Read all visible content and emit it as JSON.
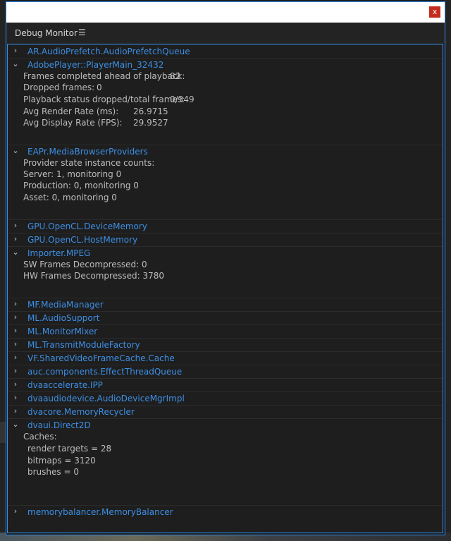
{
  "panel": {
    "title": "Debug Monitor",
    "menu_icon": "hamburger-icon",
    "close_glyph": "x"
  },
  "groups": [
    {
      "label": "AR.AudioPrefetch.AudioPrefetchQueue",
      "expanded": false
    },
    {
      "label": "AdobePlayer::PlayerMain_32432",
      "expanded": true,
      "details": [
        {
          "label": "Frames completed ahead of playback:",
          "value": "82"
        },
        {
          "label": "Dropped frames:",
          "value": "0"
        },
        {
          "label": "Playback status dropped/total frames:",
          "value": "0/349"
        },
        {
          "label": "Avg Render Rate (ms):",
          "value": "26.9715"
        },
        {
          "label": "Avg Display Rate (FPS):",
          "value": "29.9527"
        }
      ]
    },
    {
      "label": "EAPr.MediaBrowserProviders",
      "expanded": true,
      "lines": [
        "Provider state instance counts:",
        "Server: 1, monitoring 0",
        "Production: 0, monitoring 0",
        "Asset: 0, monitoring 0"
      ]
    },
    {
      "label": "GPU.OpenCL.DeviceMemory",
      "expanded": false
    },
    {
      "label": "GPU.OpenCL.HostMemory",
      "expanded": false
    },
    {
      "label": "Importer.MPEG",
      "expanded": true,
      "lines": [
        "SW Frames Decompressed: 0",
        "HW Frames Decompressed: 3780"
      ]
    },
    {
      "label": "MF.MediaManager",
      "expanded": false
    },
    {
      "label": "ML.AudioSupport",
      "expanded": false
    },
    {
      "label": "ML.MonitorMixer",
      "expanded": false
    },
    {
      "label": "ML.TransmitModuleFactory",
      "expanded": false
    },
    {
      "label": "VF.SharedVideoFrameCache.Cache",
      "expanded": false
    },
    {
      "label": "auc.components.EffectThreadQueue",
      "expanded": false
    },
    {
      "label": "dvaaccelerate.IPP",
      "expanded": false
    },
    {
      "label": "dvaaudiodevice.AudioDeviceMgrImpl",
      "expanded": false
    },
    {
      "label": "dvacore.MemoryRecycler",
      "expanded": false
    },
    {
      "label": "dvaui.Direct2D",
      "expanded": true,
      "lines": [
        "Caches:",
        "render targets = 28",
        "bitmaps = 3120",
        "brushes = 0"
      ]
    },
    {
      "label": "memorybalancer.MemoryBalancer",
      "expanded": false
    }
  ]
}
